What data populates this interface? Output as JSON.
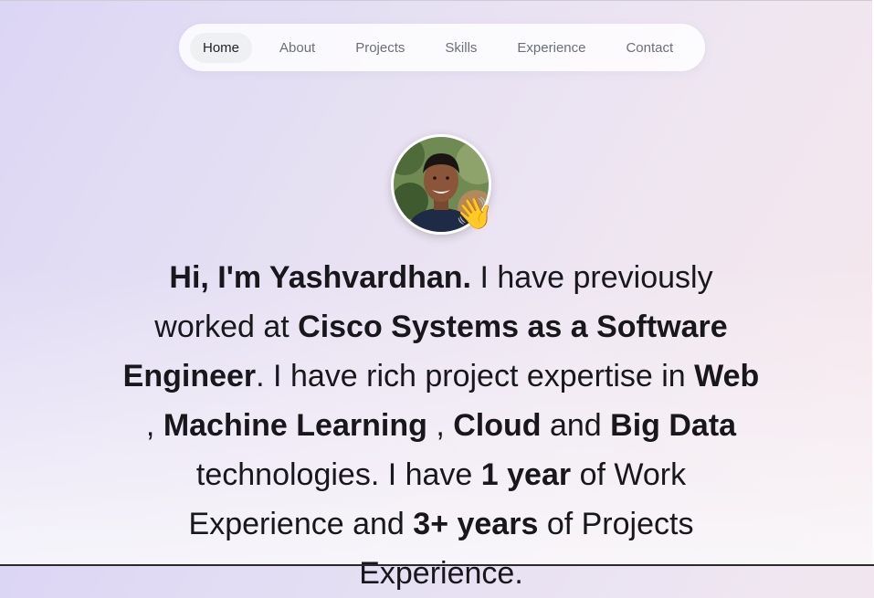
{
  "nav": {
    "items": [
      {
        "label": "Home",
        "active": true
      },
      {
        "label": "About"
      },
      {
        "label": "Projects"
      },
      {
        "label": "Skills"
      },
      {
        "label": "Experience"
      },
      {
        "label": "Contact"
      }
    ]
  },
  "hero": {
    "avatar_icon": "profile-photo",
    "wave_emoji": "👋",
    "intro": {
      "greeting": "Hi, I'm Yashvardhan.",
      "t1": " I have previously worked at ",
      "company_role": "Cisco Systems as a Software Engineer",
      "t2": ". I have rich project expertise in ",
      "skill_web": "Web",
      "sep1": " , ",
      "skill_ml": "Machine Learning",
      "sep2": " , ",
      "skill_cloud": "Cloud",
      "t3": " and ",
      "skill_bigdata": "Big Data",
      "t4": " technologies. I have ",
      "work_exp": "1 year",
      "t5": " of Work Experience and ",
      "project_exp": "3+ years",
      "t6": " of Projects Experience."
    }
  },
  "colors": {
    "bg_start": "#dcd6f5",
    "bg_end": "#f6e8ea",
    "nav_active_bg": "#eef0f2",
    "text": "#17171c"
  }
}
